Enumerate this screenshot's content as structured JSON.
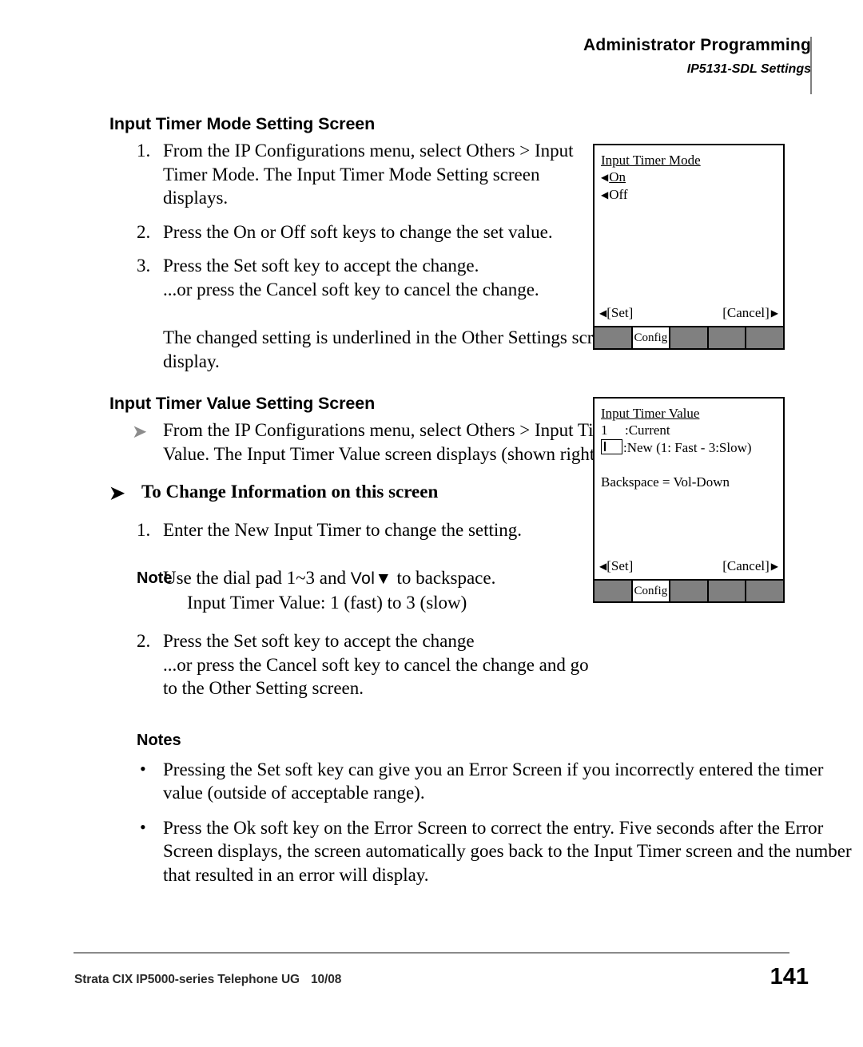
{
  "header": {
    "title": "Administrator Programming",
    "subtitle": "IP5131-SDL Settings"
  },
  "sections": [
    {
      "heading": "Input Timer Mode Setting Screen",
      "steps": [
        {
          "num": "1.",
          "text": "From the IP Configurations menu, select Others > Input Timer Mode. The Input Timer Mode Setting screen displays."
        },
        {
          "num": "2.",
          "text": "Press the On or Off soft keys to change the set value."
        },
        {
          "num": "3.",
          "text": "Press the Set soft key to accept the change.",
          "sub": "...or press the Cancel soft key to cancel the change."
        }
      ],
      "paragraph": "The changed setting is underlined in the Other Settings screen display."
    },
    {
      "heading": "Input Timer Value Setting Screen",
      "arrow_item": "From the IP Configurations menu, select Others > Input Timer Value. The Input Timer Value screen displays (shown right).",
      "procedure_heading": "To Change Information on this screen",
      "steps": [
        {
          "num": "1.",
          "text": "Enter the New Input Timer to change the setting."
        }
      ],
      "note": {
        "label": "Note",
        "line1_a": "Use the dial pad 1~3 and ",
        "line1_key": "Vol",
        "line1_tri": "▼",
        "line1_b": " to backspace.",
        "line2": "Input Timer Value: 1 (fast) to 3 (slow)"
      },
      "steps2": [
        {
          "num": "2.",
          "text": "Press the Set soft key to accept the change",
          "sub": "...or press the Cancel soft key to cancel the change and go to the Other Setting screen."
        }
      ]
    }
  ],
  "notes": {
    "heading": "Notes",
    "bullet_glyph": "•",
    "items": [
      "Pressing the Set soft key can give you an Error Screen if you incorrectly entered the timer value (outside of acceptable range).",
      "Press the Ok soft key on the Error Screen to correct the entry. Five seconds after the Error Screen displays, the screen automatically goes back to the Input Timer screen and the number that resulted in an error will display."
    ]
  },
  "lcd_mode": {
    "title": "Input Timer Mode",
    "triangle_left": "◀",
    "triangle_right": "▶",
    "option_on": "On",
    "option_off": "Off",
    "softkey_set": "[Set]",
    "softkey_cancel": "[Cancel]",
    "tabs": [
      "",
      "Config",
      "",
      "",
      ""
    ],
    "active_tab_index": 1
  },
  "lcd_value": {
    "title": "Input Timer Value",
    "triangle_left": "◀",
    "triangle_right": "▶",
    "current_num": "1",
    "current_label": ":Current",
    "new_label": ":New (1: Fast - 3:Slow)",
    "backspace_hint": "Backspace = Vol-Down",
    "softkey_set": "[Set]",
    "softkey_cancel": "[Cancel]",
    "tabs": [
      "",
      "Config",
      "",
      "",
      ""
    ],
    "active_tab_index": 1
  },
  "footer": {
    "doc_title": "Strata CIX IP5000-series Telephone UG",
    "date": "10/08",
    "page_number": "141"
  },
  "colors": {
    "tab_gray": "#808080",
    "rule_gray": "#8a8a8a",
    "arrow_gray": "#8c8c8c"
  }
}
